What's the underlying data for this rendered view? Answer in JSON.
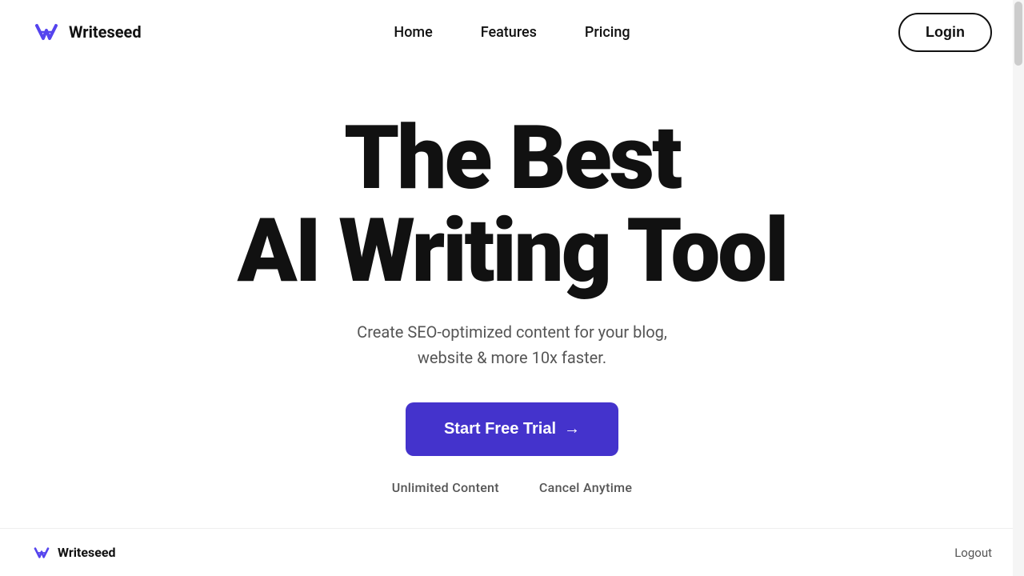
{
  "brand": {
    "name": "Writeseed",
    "logo_alt": "Writeseed logo"
  },
  "nav": {
    "links": [
      {
        "label": "Home",
        "id": "home"
      },
      {
        "label": "Features",
        "id": "features"
      },
      {
        "label": "Pricing",
        "id": "pricing"
      }
    ],
    "login_label": "Login"
  },
  "hero": {
    "title_line1": "The Best",
    "title_line2": "AI Writing Tool",
    "subtitle_line1": "Create SEO-optimized content for your blog,",
    "subtitle_line2": "website & more 10x faster.",
    "cta_label": "Start Free Trial",
    "cta_arrow": "→"
  },
  "badges": [
    {
      "label": "Unlimited Content"
    },
    {
      "label": "Cancel Anytime"
    }
  ],
  "footer": {
    "logo_name": "Writeseed",
    "logout_label": "Logout"
  }
}
